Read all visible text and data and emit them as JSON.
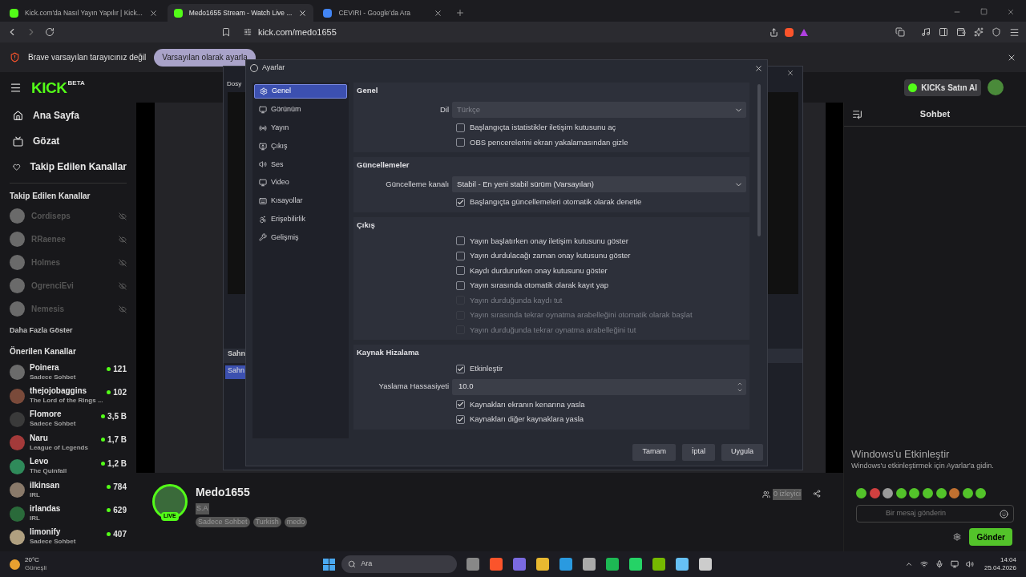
{
  "browser": {
    "tabs": [
      {
        "title": "Kick.com'da Nasıl Yayın Yapılır | Kick...",
        "selected": false
      },
      {
        "title": "Medo1655 Stream - Watch Live ...",
        "selected": true
      },
      {
        "title": "CEVIRI - Google'da Ara",
        "selected": false
      }
    ],
    "url": "kick.com/medo1655",
    "infobar": {
      "message": "Brave varsayılan tarayıcınız değil",
      "button": "Varsayılan olarak ayarla"
    }
  },
  "sidebar": {
    "logo": "KICK",
    "logo_badge": "BETA",
    "nav": [
      {
        "label": "Ana Sayfa"
      },
      {
        "label": "Gözat"
      },
      {
        "label": "Takip Edilen Kanallar"
      }
    ],
    "followed_title": "Takip Edilen Kanallar",
    "followed": [
      {
        "name": "Cordiseps"
      },
      {
        "name": "RRaenee"
      },
      {
        "name": "Holmes"
      },
      {
        "name": "OgrenciEvi"
      },
      {
        "name": "Nemesis"
      }
    ],
    "show_more": "Daha Fazla Göster",
    "recommended_title": "Önerilen Kanallar",
    "recommended": [
      {
        "name": "Poinera",
        "category": "Sadece Sohbet",
        "viewers": "121"
      },
      {
        "name": "thejojobaggins",
        "category": "The Lord of the Rings ...",
        "viewers": "102"
      },
      {
        "name": "Flomore",
        "category": "Sadece Sohbet",
        "viewers": "3,5 B"
      },
      {
        "name": "Naru",
        "category": "League of Legends",
        "viewers": "1,7 B"
      },
      {
        "name": "Levo",
        "category": "The Quinfall",
        "viewers": "1,2 B"
      },
      {
        "name": "ilkinsan",
        "category": "IRL",
        "viewers": "784"
      },
      {
        "name": "irlandas",
        "category": "IRL",
        "viewers": "629"
      },
      {
        "name": "limonify",
        "category": "Sadece Sohbet",
        "viewers": "407"
      }
    ]
  },
  "header": {
    "kicks_button": "KICKs Satın Al"
  },
  "obs_window": {
    "menu": "Dosy",
    "scene_header": "Sahn",
    "scene_item": "Sahn"
  },
  "settings": {
    "title": "Ayarlar",
    "nav": [
      {
        "label": "Genel",
        "selected": true
      },
      {
        "label": "Görünüm",
        "selected": false
      },
      {
        "label": "Yayın",
        "selected": false
      },
      {
        "label": "Çıkış",
        "selected": false
      },
      {
        "label": "Ses",
        "selected": false
      },
      {
        "label": "Video",
        "selected": false
      },
      {
        "label": "Kısayollar",
        "selected": false
      },
      {
        "label": "Erişebilirlik",
        "selected": false
      },
      {
        "label": "Gelişmiş",
        "selected": false
      }
    ],
    "sections": [
      {
        "title": "Genel",
        "rows": [
          {
            "kind": "select",
            "label": "Dil",
            "value": "Türkçe",
            "disabled": true
          },
          {
            "kind": "checkbox",
            "label": "Başlangıçta istatistikler iletişim kutusunu aç",
            "checked": false,
            "disabled": false
          },
          {
            "kind": "checkbox",
            "label": "OBS pencerelerini ekran yakalamasından gizle",
            "checked": false,
            "disabled": false
          }
        ]
      },
      {
        "title": "Güncellemeler",
        "rows": [
          {
            "kind": "select",
            "label": "Güncelleme kanalı",
            "value": "Stabil - En yeni stabil sürüm (Varsayılan)",
            "disabled": false
          },
          {
            "kind": "checkbox",
            "label": "Başlangıçta güncellemeleri otomatik olarak denetle",
            "checked": true,
            "disabled": false
          }
        ]
      },
      {
        "title": "Çıkış",
        "rows": [
          {
            "kind": "checkbox",
            "label": "Yayın başlatırken onay iletişim kutusunu göster",
            "checked": false,
            "disabled": false
          },
          {
            "kind": "checkbox",
            "label": "Yayın durdulacağı zaman onay kutusunu göster",
            "checked": false,
            "disabled": false
          },
          {
            "kind": "checkbox",
            "label": "Kaydı durdururken onay kutusunu göster",
            "checked": false,
            "disabled": false
          },
          {
            "kind": "checkbox",
            "label": "Yayın sırasında otomatik olarak kayıt yap",
            "checked": false,
            "disabled": false
          },
          {
            "kind": "checkbox",
            "label": "Yayın durduğunda kaydı tut",
            "checked": false,
            "disabled": true
          },
          {
            "kind": "checkbox",
            "label": "Yayın sırasında tekrar oynatma arabelleğini otomatik olarak başlat",
            "checked": false,
            "disabled": true
          },
          {
            "kind": "checkbox",
            "label": "Yayın durduğunda tekrar oynatma arabelleğini tut",
            "checked": false,
            "disabled": true
          }
        ]
      },
      {
        "title": "Kaynak Hizalama",
        "rows": [
          {
            "kind": "checkbox",
            "label": "Etkinleştir",
            "checked": true,
            "disabled": false
          },
          {
            "kind": "spin",
            "label": "Yaslama Hassasiyeti",
            "value": "10.0",
            "disabled": false
          },
          {
            "kind": "checkbox",
            "label": "Kaynakları ekranın kenarına yasla",
            "checked": true,
            "disabled": false
          },
          {
            "kind": "checkbox",
            "label": "Kaynakları diğer kaynaklara yasla",
            "checked": true,
            "disabled": false
          }
        ]
      }
    ],
    "buttons": [
      "Tamam",
      "İptal",
      "Uygula"
    ]
  },
  "channel": {
    "name": "Medo1655",
    "live_badge": "LIVE",
    "title": "S.A",
    "tags": [
      "Sadece Sohbet",
      "Turkish",
      "medo"
    ],
    "viewers": "0 izleyici"
  },
  "chat": {
    "title": "Sohbet",
    "placeholder": "Bir mesaj gönderin",
    "send": "Gönder"
  },
  "activation": {
    "title": "Windows'u Etkinleştir",
    "text": "Windows'u etkinleştirmek için Ayarlar'a gidin."
  },
  "taskbar": {
    "weather_temp": "20°C",
    "weather_text": "Güneşli",
    "search_placeholder": "Ara",
    "time": "14:04",
    "date": "25.04.2026"
  }
}
